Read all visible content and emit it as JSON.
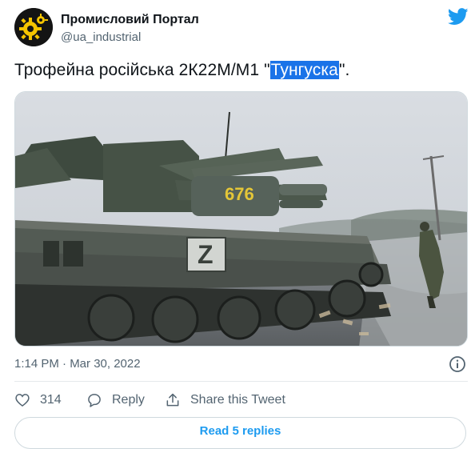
{
  "author": {
    "name": "Промисловий Портал",
    "handle": "@ua_industrial",
    "avatar_icon": "gear-logo-icon",
    "brand_color": "#f5c400"
  },
  "platform_icon": "twitter-bird-icon",
  "tweet": {
    "text_before": "Трофейна російська 2К22М/М1 \"",
    "text_highlight": "Тунгуска",
    "text_after": "\".",
    "media": {
      "vehicle_number": "676",
      "vehicle_mark": "Z"
    },
    "timestamp": "1:14 PM · Mar 30, 2022"
  },
  "actions": {
    "like_count": "314",
    "reply_label": "Reply",
    "share_label": "Share this Tweet"
  },
  "replies_button": "Read 5 replies",
  "colors": {
    "accent": "#1d9bf0",
    "secondary_text": "#536471",
    "highlight": "#1a73e8"
  }
}
